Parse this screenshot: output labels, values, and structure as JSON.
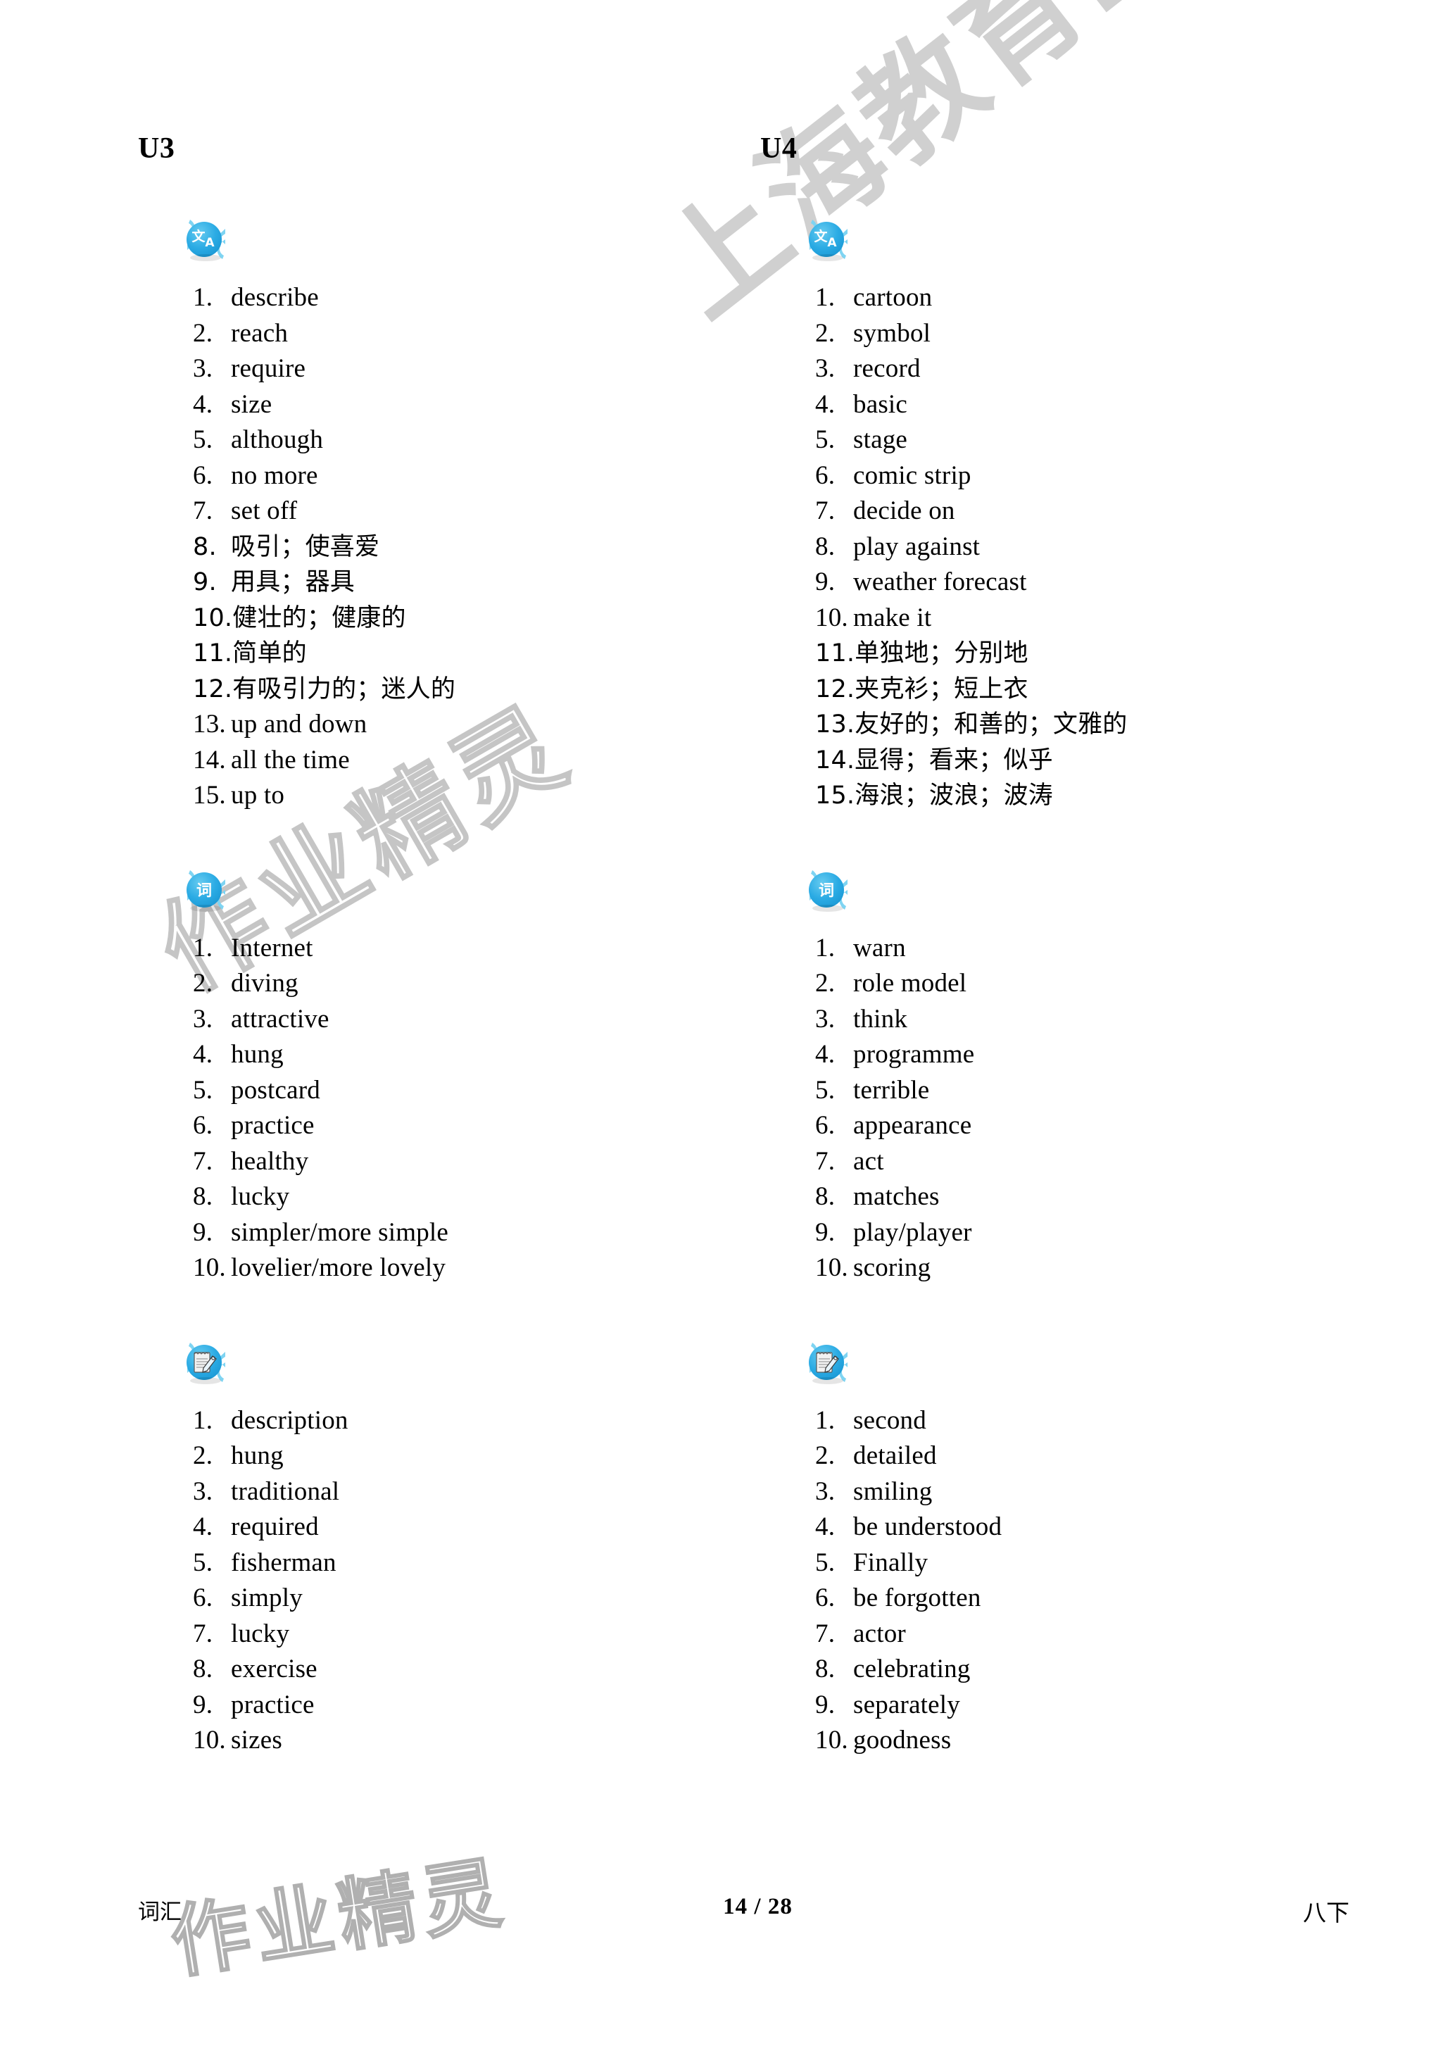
{
  "page": {
    "footer": {
      "left_label": "词汇",
      "page_indicator": "14 / 28",
      "right_label": "八下"
    },
    "watermarks": {
      "diagonal_large": "上海教育出版社",
      "diagonal_mid": "作业精灵",
      "footer_mark": "作业精灵"
    }
  },
  "columns": [
    {
      "unit": "U3",
      "sections": [
        {
          "icon": "translate-icon",
          "icon_glyph": "文A",
          "items": [
            {
              "num": "1.",
              "text": "describe",
              "lang": "en"
            },
            {
              "num": "2.",
              "text": "reach",
              "lang": "en"
            },
            {
              "num": "3.",
              "text": "require",
              "lang": "en"
            },
            {
              "num": "4.",
              "text": "size",
              "lang": "en"
            },
            {
              "num": "5.",
              "text": "although",
              "lang": "en"
            },
            {
              "num": "6.",
              "text": "no more",
              "lang": "en"
            },
            {
              "num": "7.",
              "text": "set off",
              "lang": "en"
            },
            {
              "num": "8.",
              "text": "吸引；使喜爱",
              "lang": "cn"
            },
            {
              "num": "9.",
              "text": "用具；器具",
              "lang": "cn"
            },
            {
              "num": "10.",
              "text": "健壮的；健康的",
              "lang": "cn"
            },
            {
              "num": "11.",
              "text": "简单的",
              "lang": "cn"
            },
            {
              "num": "12.",
              "text": "有吸引力的；迷人的",
              "lang": "cn"
            },
            {
              "num": "13.",
              "text": "up and down",
              "lang": "en"
            },
            {
              "num": "14.",
              "text": "all the time",
              "lang": "en"
            },
            {
              "num": "15.",
              "text": "up to",
              "lang": "en"
            }
          ]
        },
        {
          "icon": "word-icon",
          "icon_glyph": "词",
          "items": [
            {
              "num": "1.",
              "text": "Internet",
              "lang": "en"
            },
            {
              "num": "2.",
              "text": "diving",
              "lang": "en"
            },
            {
              "num": "3.",
              "text": "attractive",
              "lang": "en"
            },
            {
              "num": "4.",
              "text": "hung",
              "lang": "en"
            },
            {
              "num": "5.",
              "text": "postcard",
              "lang": "en"
            },
            {
              "num": "6.",
              "text": "practice",
              "lang": "en"
            },
            {
              "num": "7.",
              "text": "healthy",
              "lang": "en"
            },
            {
              "num": "8.",
              "text": "lucky",
              "lang": "en"
            },
            {
              "num": "9.",
              "text": "simpler/more simple",
              "lang": "en"
            },
            {
              "num": "10.",
              "text": "lovelier/more lovely",
              "lang": "en"
            }
          ]
        },
        {
          "icon": "write-note-icon",
          "icon_glyph": "notepad-pencil",
          "items": [
            {
              "num": "1.",
              "text": "description",
              "lang": "en"
            },
            {
              "num": "2.",
              "text": "hung",
              "lang": "en"
            },
            {
              "num": "3.",
              "text": "traditional",
              "lang": "en"
            },
            {
              "num": "4.",
              "text": "required",
              "lang": "en"
            },
            {
              "num": "5.",
              "text": "fisherman",
              "lang": "en"
            },
            {
              "num": "6.",
              "text": "simply",
              "lang": "en"
            },
            {
              "num": "7.",
              "text": "lucky",
              "lang": "en"
            },
            {
              "num": "8.",
              "text": "exercise",
              "lang": "en"
            },
            {
              "num": "9.",
              "text": "practice",
              "lang": "en"
            },
            {
              "num": "10.",
              "text": "sizes",
              "lang": "en"
            }
          ]
        }
      ]
    },
    {
      "unit": "U4",
      "sections": [
        {
          "icon": "translate-icon",
          "icon_glyph": "文A",
          "items": [
            {
              "num": "1.",
              "text": "cartoon",
              "lang": "en"
            },
            {
              "num": "2.",
              "text": "symbol",
              "lang": "en"
            },
            {
              "num": "3.",
              "text": "record",
              "lang": "en"
            },
            {
              "num": "4.",
              "text": "basic",
              "lang": "en"
            },
            {
              "num": "5.",
              "text": "stage",
              "lang": "en"
            },
            {
              "num": "6.",
              "text": "comic strip",
              "lang": "en"
            },
            {
              "num": "7.",
              "text": "decide on",
              "lang": "en"
            },
            {
              "num": "8.",
              "text": "play against",
              "lang": "en"
            },
            {
              "num": "9.",
              "text": "weather forecast",
              "lang": "en"
            },
            {
              "num": "10.",
              "text": "make it",
              "lang": "en"
            },
            {
              "num": "11.",
              "text": "单独地；分别地",
              "lang": "cn"
            },
            {
              "num": "12.",
              "text": "夹克衫；短上衣",
              "lang": "cn"
            },
            {
              "num": "13.",
              "text": "友好的；和善的；文雅的",
              "lang": "cn"
            },
            {
              "num": "14.",
              "text": "显得；看来；似乎",
              "lang": "cn"
            },
            {
              "num": "15.",
              "text": "海浪；波浪；波涛",
              "lang": "cn"
            }
          ]
        },
        {
          "icon": "word-icon",
          "icon_glyph": "词",
          "items": [
            {
              "num": "1.",
              "text": "warn",
              "lang": "en"
            },
            {
              "num": "2.",
              "text": "role model",
              "lang": "en"
            },
            {
              "num": "3.",
              "text": "think",
              "lang": "en"
            },
            {
              "num": "4.",
              "text": "programme",
              "lang": "en"
            },
            {
              "num": "5.",
              "text": "terrible",
              "lang": "en"
            },
            {
              "num": "6.",
              "text": "appearance",
              "lang": "en"
            },
            {
              "num": "7.",
              "text": "act",
              "lang": "en"
            },
            {
              "num": "8.",
              "text": "matches",
              "lang": "en"
            },
            {
              "num": "9.",
              "text": "play/player",
              "lang": "en"
            },
            {
              "num": "10.",
              "text": "scoring",
              "lang": "en"
            }
          ]
        },
        {
          "icon": "write-note-icon",
          "icon_glyph": "notepad-pencil",
          "items": [
            {
              "num": "1.",
              "text": "second",
              "lang": "en"
            },
            {
              "num": "2.",
              "text": "detailed",
              "lang": "en"
            },
            {
              "num": "3.",
              "text": "smiling",
              "lang": "en"
            },
            {
              "num": "4.",
              "text": "be understood",
              "lang": "en"
            },
            {
              "num": "5.",
              "text": "Finally",
              "lang": "en"
            },
            {
              "num": "6.",
              "text": "be forgotten",
              "lang": "en"
            },
            {
              "num": "7.",
              "text": "actor",
              "lang": "en"
            },
            {
              "num": "8.",
              "text": "celebrating",
              "lang": "en"
            },
            {
              "num": "9.",
              "text": "separately",
              "lang": "en"
            },
            {
              "num": "10.",
              "text": "goodness",
              "lang": "en"
            }
          ]
        }
      ]
    }
  ],
  "colors": {
    "icon_blue": "#29ABE2",
    "icon_blue_light": "#7FD4F2",
    "text": "#000000",
    "watermark_gray": "#969696"
  }
}
